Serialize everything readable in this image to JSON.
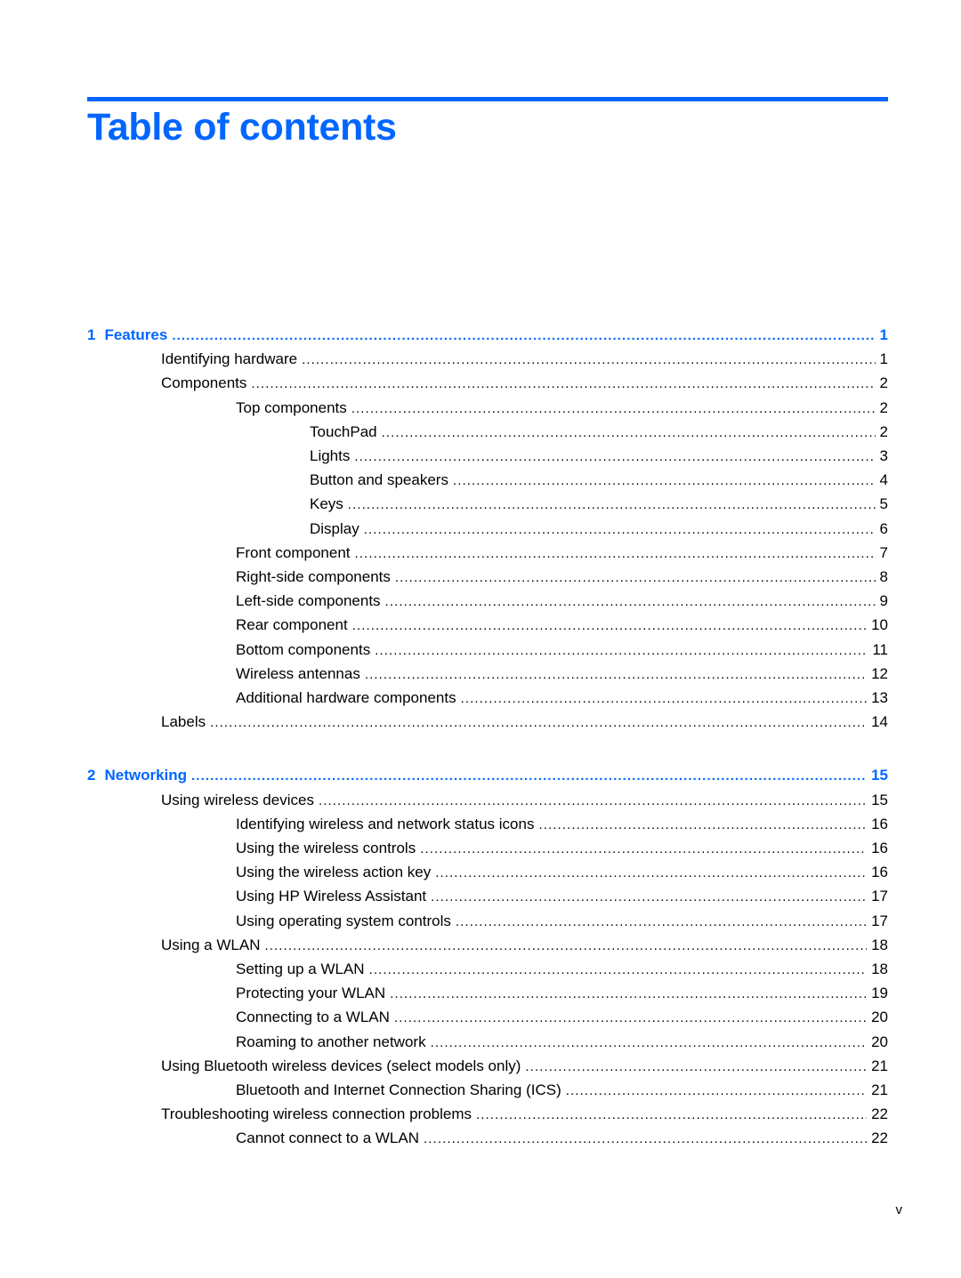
{
  "page": {
    "title": "Table of contents",
    "page_number": "v",
    "accent_color": "#0066ff"
  },
  "toc": [
    {
      "level": 0,
      "num": "1",
      "label": "Features",
      "page": "1"
    },
    {
      "level": 1,
      "label": "Identifying hardware",
      "page": "1"
    },
    {
      "level": 1,
      "label": "Components",
      "page": "2"
    },
    {
      "level": 2,
      "label": "Top components",
      "page": "2"
    },
    {
      "level": 3,
      "label": "TouchPad",
      "page": "2"
    },
    {
      "level": 3,
      "label": "Lights",
      "page": "3"
    },
    {
      "level": 3,
      "label": "Button and speakers",
      "page": "4"
    },
    {
      "level": 3,
      "label": "Keys",
      "page": "5"
    },
    {
      "level": 3,
      "label": "Display",
      "page": "6"
    },
    {
      "level": 2,
      "label": "Front component",
      "page": "7"
    },
    {
      "level": 2,
      "label": "Right-side components",
      "page": "8"
    },
    {
      "level": 2,
      "label": "Left-side components",
      "page": "9"
    },
    {
      "level": 2,
      "label": "Rear component",
      "page": "10"
    },
    {
      "level": 2,
      "label": "Bottom components",
      "page": "11"
    },
    {
      "level": 2,
      "label": "Wireless antennas",
      "page": "12"
    },
    {
      "level": 2,
      "label": "Additional hardware components",
      "page": "13"
    },
    {
      "level": 1,
      "label": "Labels",
      "page": "14"
    },
    {
      "level": 0,
      "num": "2",
      "label": "Networking",
      "page": "15"
    },
    {
      "level": 1,
      "label": "Using wireless devices",
      "page": "15"
    },
    {
      "level": 2,
      "label": "Identifying wireless and network status icons",
      "page": "16"
    },
    {
      "level": 2,
      "label": "Using the wireless controls",
      "page": "16"
    },
    {
      "level": 2,
      "label": "Using the wireless action key",
      "page": "16"
    },
    {
      "level": 2,
      "label": "Using HP Wireless Assistant",
      "page": "17"
    },
    {
      "level": 2,
      "label": "Using operating system controls",
      "page": "17"
    },
    {
      "level": 1,
      "label": "Using a WLAN",
      "page": "18"
    },
    {
      "level": 2,
      "label": "Setting up a WLAN",
      "page": "18"
    },
    {
      "level": 2,
      "label": "Protecting your WLAN",
      "page": "19"
    },
    {
      "level": 2,
      "label": "Connecting to a WLAN",
      "page": "20"
    },
    {
      "level": 2,
      "label": "Roaming to another network",
      "page": "20"
    },
    {
      "level": 1,
      "label": "Using Bluetooth wireless devices (select models only)",
      "page": "21"
    },
    {
      "level": 2,
      "label": "Bluetooth and Internet Connection Sharing (ICS)",
      "page": "21"
    },
    {
      "level": 1,
      "label": "Troubleshooting wireless connection problems",
      "page": "22"
    },
    {
      "level": 2,
      "label": "Cannot connect to a WLAN",
      "page": "22"
    }
  ]
}
